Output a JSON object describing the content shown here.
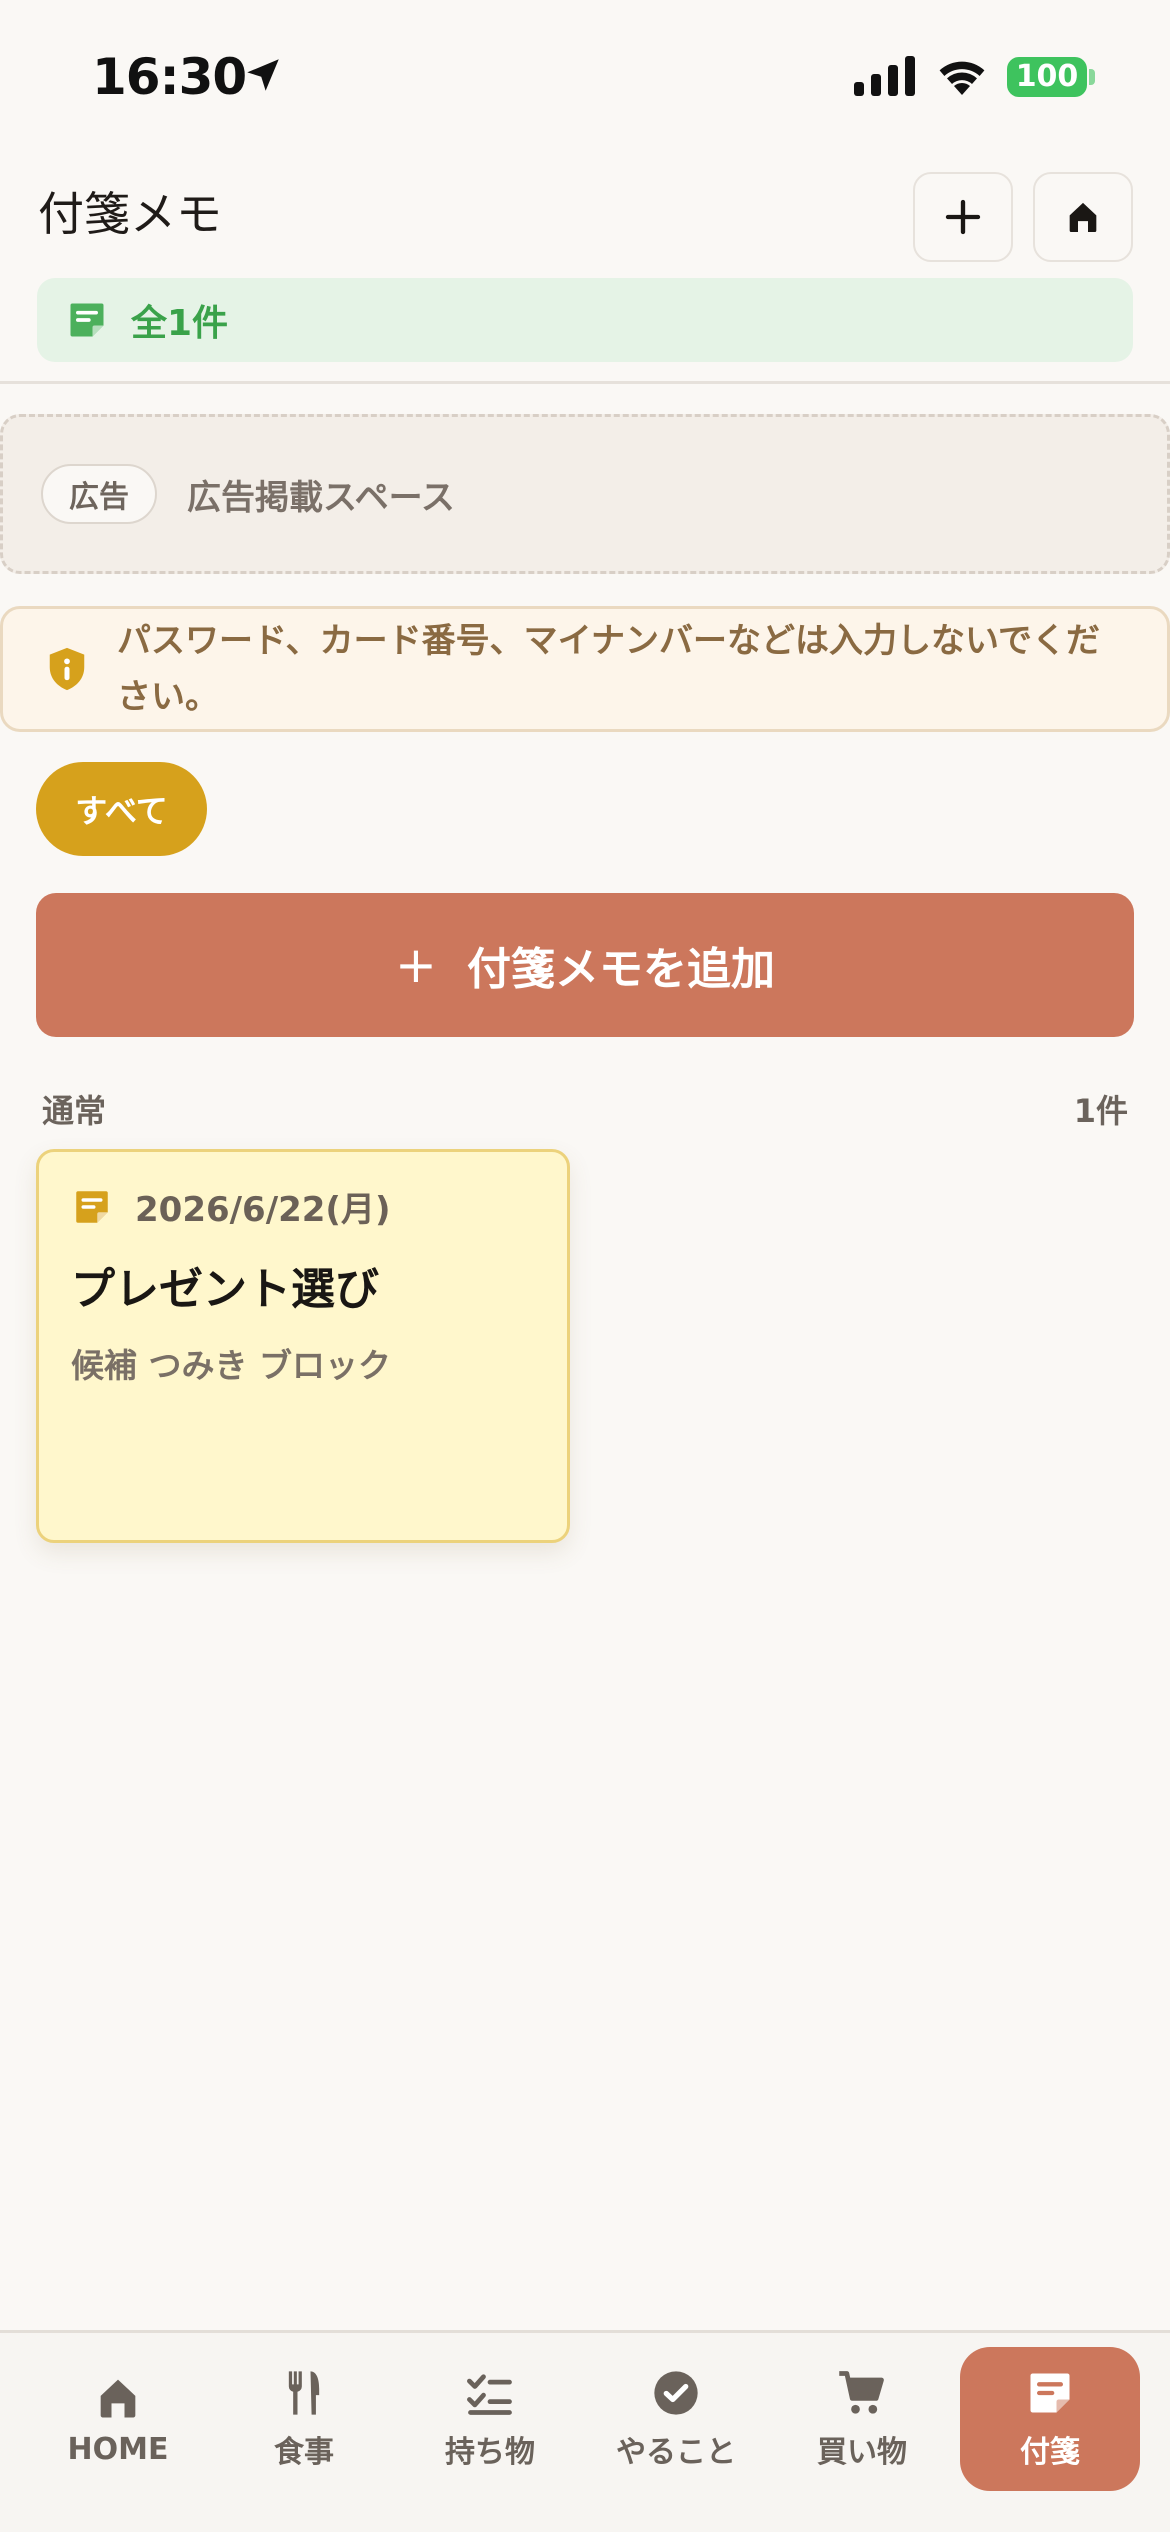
{
  "status_bar": {
    "time": "16:30",
    "battery": "100"
  },
  "header": {
    "title": "付箋メモ"
  },
  "summary": {
    "count_label": "全1件"
  },
  "ad": {
    "badge": "広告",
    "text": "広告掲載スペース"
  },
  "warning": {
    "text": "パスワード、カード番号、マイナンバーなどは入力しないでください。"
  },
  "filter": {
    "all_label": "すべて"
  },
  "add_button": {
    "plus": "+",
    "label": "付箋メモを追加"
  },
  "section": {
    "label": "通常",
    "count": "1件"
  },
  "memos": [
    {
      "date": "2026/6/22(月)",
      "title": "プレゼント選び",
      "body": "候補 つみき ブロック"
    }
  ],
  "tabs": [
    {
      "label": "HOME",
      "icon": "home-icon"
    },
    {
      "label": "食事",
      "icon": "fork-knife-icon"
    },
    {
      "label": "持ち物",
      "icon": "checklist-icon"
    },
    {
      "label": "やること",
      "icon": "check-circle-icon"
    },
    {
      "label": "買い物",
      "icon": "cart-icon"
    },
    {
      "label": "付箋",
      "icon": "sticky-note-icon",
      "active": true
    }
  ],
  "colors": {
    "accent": "#cc775c",
    "gold": "#d6a11c",
    "green": "#3aa24a",
    "note_bg": "#fff7cc"
  }
}
